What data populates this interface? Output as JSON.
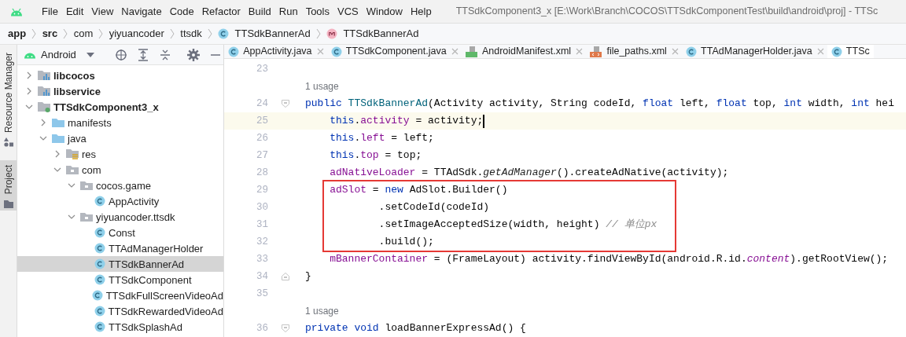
{
  "menu_bar": {
    "items": [
      "File",
      "Edit",
      "View",
      "Navigate",
      "Code",
      "Refactor",
      "Build",
      "Run",
      "Tools",
      "VCS",
      "Window",
      "Help"
    ],
    "title": "TTSdkComponent3_x [E:\\Work\\Branch\\COCOS\\TTSdkComponentTest\\build\\android\\proj] - TTSc"
  },
  "breadcrumb": [
    {
      "label": "app",
      "bold": true
    },
    {
      "label": "src",
      "bold": true
    },
    {
      "label": "com",
      "bold": false
    },
    {
      "label": "yiyuancoder",
      "bold": false
    },
    {
      "label": "ttsdk",
      "bold": false
    },
    {
      "label": "TTSdkBannerAd",
      "bold": false,
      "kind": "class"
    },
    {
      "label": "TTSdkBannerAd",
      "bold": false,
      "kind": "method"
    }
  ],
  "side_tabs": [
    {
      "label": "Resource Manager",
      "selected": false,
      "kind": "shapes"
    },
    {
      "label": "Project",
      "selected": true,
      "kind": "folder"
    }
  ],
  "project_panel": {
    "view": "Android",
    "tree": [
      {
        "label": "libcocos",
        "kind": "library-module",
        "bold": true,
        "expanded": false,
        "selected": false
      },
      {
        "label": "libservice",
        "kind": "library-module",
        "bold": true,
        "expanded": false,
        "selected": false
      },
      {
        "label": "TTSdkComponent3_x",
        "kind": "app-module",
        "bold": true,
        "expanded": true,
        "selected": false,
        "children": [
          {
            "label": "manifests",
            "kind": "folder",
            "expanded": false,
            "selected": false
          },
          {
            "label": "java",
            "kind": "folder",
            "expanded": true,
            "selected": false,
            "children": [
              {
                "label": "res",
                "kind": "resource-folder",
                "expanded": false,
                "selected": false
              },
              {
                "label": "com",
                "kind": "package",
                "expanded": true,
                "selected": false,
                "children": [
                  {
                    "label": "cocos.game",
                    "kind": "package",
                    "expanded": true,
                    "selected": false,
                    "children": [
                      {
                        "label": "AppActivity",
                        "kind": "class",
                        "selected": false
                      }
                    ]
                  },
                  {
                    "label": "yiyuancoder.ttsdk",
                    "kind": "package",
                    "expanded": true,
                    "selected": false,
                    "children": [
                      {
                        "label": "Const",
                        "kind": "class",
                        "selected": false
                      },
                      {
                        "label": "TTAdManagerHolder",
                        "kind": "class",
                        "selected": false
                      },
                      {
                        "label": "TTSdkBannerAd",
                        "kind": "class",
                        "selected": true
                      },
                      {
                        "label": "TTSdkComponent",
                        "kind": "class",
                        "selected": false
                      },
                      {
                        "label": "TTSdkFullScreenVideoAd",
                        "kind": "class",
                        "selected": false
                      },
                      {
                        "label": "TTSdkRewardedVideoAd",
                        "kind": "class",
                        "selected": false
                      },
                      {
                        "label": "TTSdkSplashAd",
                        "kind": "class",
                        "selected": false
                      }
                    ]
                  }
                ]
              }
            ]
          }
        ]
      }
    ]
  },
  "editor_tabs": [
    {
      "label": "AppActivity.java",
      "kind": "class",
      "selected": false
    },
    {
      "label": "TTSdkComponent.java",
      "kind": "class",
      "selected": false
    },
    {
      "label": "AndroidManifest.xml",
      "kind": "manifest",
      "selected": false
    },
    {
      "label": "file_paths.xml",
      "kind": "xml",
      "selected": false
    },
    {
      "label": "TTAdManagerHolder.java",
      "kind": "class",
      "selected": false
    },
    {
      "label": "TTSc",
      "kind": "class",
      "selected": true
    }
  ],
  "code_lines": [
    {
      "kind": "code",
      "number": "23",
      "current": false,
      "boxed": false
    },
    {
      "kind": "hint",
      "text": "1 usage"
    },
    {
      "kind": "block-start",
      "number": "24",
      "current": false,
      "boxed": false,
      "tokens": [
        {
          "text": "public ",
          "kind": "kw"
        },
        {
          "text": "TTSdkBannerAd",
          "kind": "decl"
        },
        {
          "text": "(Activity activity, String codeId, ",
          "kind": "plain"
        },
        {
          "text": "float",
          "kind": "kw"
        },
        {
          "text": " left, ",
          "kind": "plain"
        },
        {
          "text": "float",
          "kind": "kw"
        },
        {
          "text": " top, ",
          "kind": "plain"
        },
        {
          "text": "int",
          "kind": "kw"
        },
        {
          "text": " width, ",
          "kind": "plain"
        },
        {
          "text": "int",
          "kind": "kw"
        },
        {
          "text": " hei",
          "kind": "plain"
        }
      ]
    },
    {
      "kind": "code",
      "number": "25",
      "current": true,
      "boxed": false,
      "tokens": [
        {
          "text": "    this",
          "kind": "kw"
        },
        {
          "text": ".",
          "kind": "plain"
        },
        {
          "text": "activity",
          "kind": "field"
        },
        {
          "text": " = activity;",
          "kind": "plain"
        }
      ]
    },
    {
      "kind": "code",
      "number": "26",
      "current": false,
      "boxed": false,
      "tokens": [
        {
          "text": "    this",
          "kind": "kw"
        },
        {
          "text": ".",
          "kind": "plain"
        },
        {
          "text": "left",
          "kind": "field"
        },
        {
          "text": " = left;",
          "kind": "plain"
        }
      ]
    },
    {
      "kind": "code",
      "number": "27",
      "current": false,
      "boxed": false,
      "tokens": [
        {
          "text": "    this",
          "kind": "kw"
        },
        {
          "text": ".",
          "kind": "plain"
        },
        {
          "text": "top",
          "kind": "field"
        },
        {
          "text": " = top;",
          "kind": "plain"
        }
      ]
    },
    {
      "kind": "code",
      "number": "28",
      "current": false,
      "boxed": false,
      "tokens": [
        {
          "text": "    adNativeLoader",
          "kind": "field"
        },
        {
          "text": " = TTAdSdk.",
          "kind": "plain"
        },
        {
          "text": "getAdManager",
          "kind": "static"
        },
        {
          "text": "().createAdNative(activity);",
          "kind": "plain"
        }
      ]
    },
    {
      "kind": "code",
      "number": "29",
      "current": false,
      "boxed": true,
      "tokens": [
        {
          "text": "    adSlot",
          "kind": "field"
        },
        {
          "text": " = ",
          "kind": "plain"
        },
        {
          "text": "new",
          "kind": "kw"
        },
        {
          "text": " AdSlot.Builder()",
          "kind": "plain"
        }
      ]
    },
    {
      "kind": "code",
      "number": "30",
      "current": false,
      "boxed": true,
      "tokens": [
        {
          "text": "            .setCodeId(codeId)",
          "kind": "plain"
        }
      ]
    },
    {
      "kind": "code",
      "number": "31",
      "current": false,
      "boxed": true,
      "tokens": [
        {
          "text": "            .setImageAcceptedSize(width, height) ",
          "kind": "plain"
        },
        {
          "text": "// 单位px",
          "kind": "comment"
        }
      ]
    },
    {
      "kind": "code",
      "number": "32",
      "current": false,
      "boxed": true,
      "tokens": [
        {
          "text": "            .build();",
          "kind": "plain"
        }
      ]
    },
    {
      "kind": "code",
      "number": "33",
      "current": false,
      "boxed": false,
      "tokens": [
        {
          "text": "    mBannerContainer",
          "kind": "field"
        },
        {
          "text": " = (FrameLayout) activity.findViewById(android.R.id.",
          "kind": "plain"
        },
        {
          "text": "content",
          "kind": "static-field"
        },
        {
          "text": ").getRootView();",
          "kind": "plain"
        }
      ]
    },
    {
      "kind": "block-end",
      "number": "34",
      "current": false,
      "boxed": false,
      "tokens": [
        {
          "text": "}",
          "kind": "plain"
        }
      ]
    },
    {
      "kind": "code",
      "number": "35",
      "current": false,
      "boxed": false
    },
    {
      "kind": "hint",
      "text": "1 usage"
    },
    {
      "kind": "block-start",
      "number": "36",
      "current": false,
      "boxed": false,
      "tokens": [
        {
          "text": "private ",
          "kind": "kw"
        },
        {
          "text": "void",
          "kind": "kw"
        },
        {
          "text": " loadBannerExpressAd() {",
          "kind": "plain"
        }
      ]
    }
  ]
}
